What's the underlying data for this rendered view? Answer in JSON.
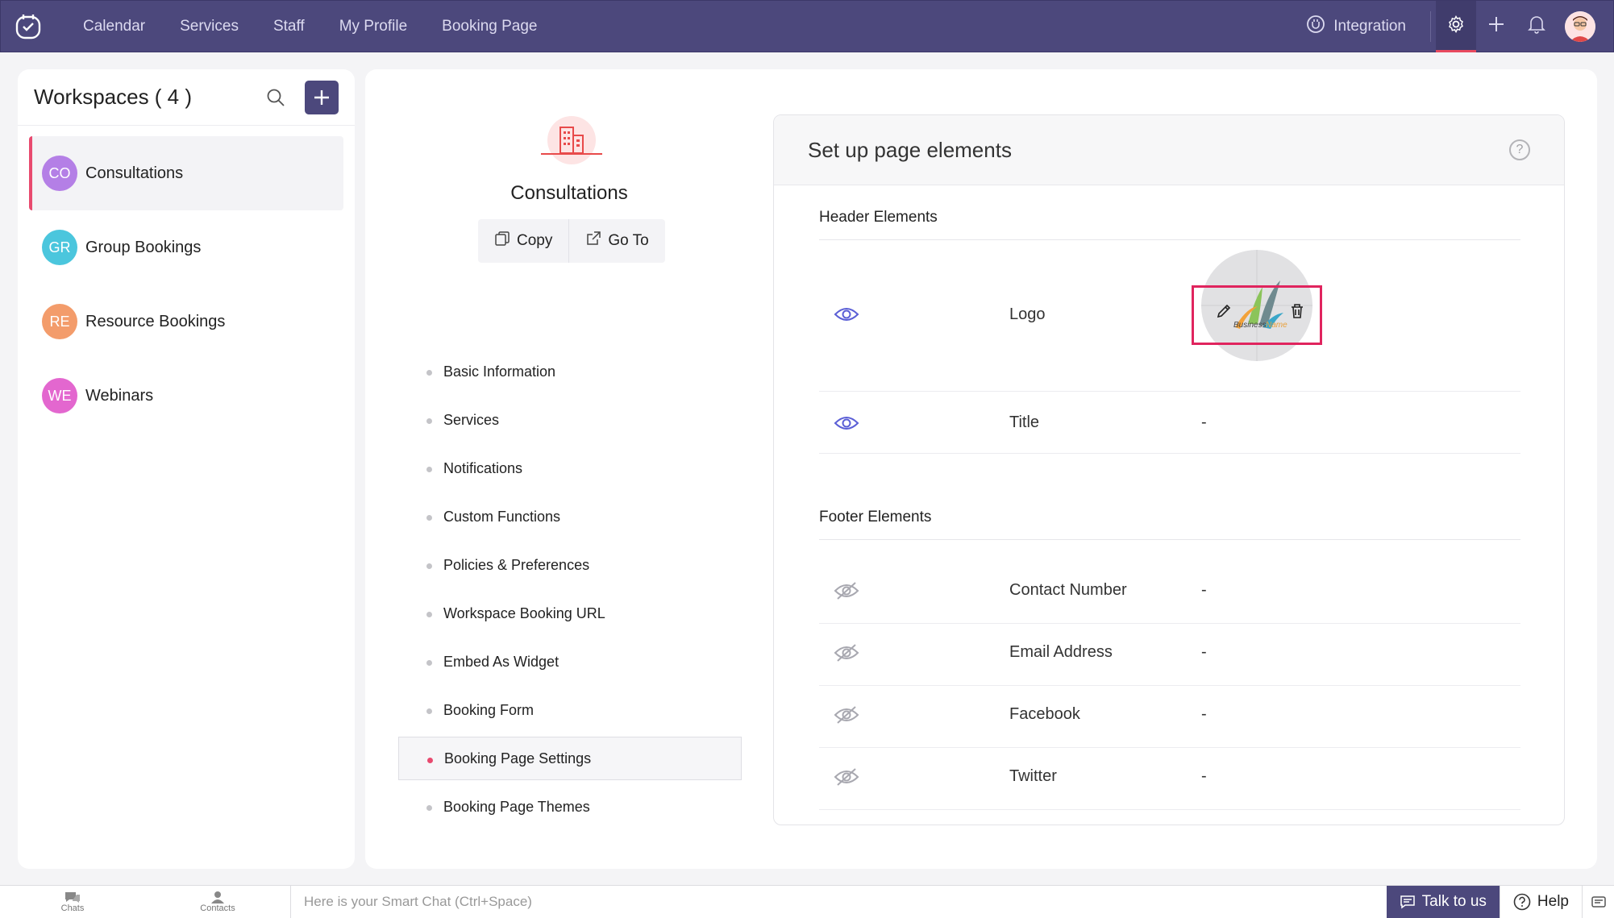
{
  "nav": {
    "links": [
      "Calendar",
      "Services",
      "Staff",
      "My Profile",
      "Booking Page"
    ],
    "integration": "Integration"
  },
  "sidebar": {
    "title": "Workspaces ( 4 )",
    "items": [
      {
        "initials": "CO",
        "label": "Consultations",
        "color": "#b47fe6"
      },
      {
        "initials": "GR",
        "label": "Group Bookings",
        "color": "#4bc6dd"
      },
      {
        "initials": "RE",
        "label": "Resource Bookings",
        "color": "#f39c6b"
      },
      {
        "initials": "WE",
        "label": "Webinars",
        "color": "#e367cf"
      }
    ]
  },
  "workspace": {
    "name": "Consultations",
    "copy_label": "Copy",
    "goto_label": "Go To"
  },
  "menu": [
    "Basic Information",
    "Services",
    "Notifications",
    "Custom Functions",
    "Policies & Preferences",
    "Workspace Booking URL",
    "Embed As Widget",
    "Booking Form",
    "Booking Page Settings",
    "Booking Page Themes"
  ],
  "card": {
    "title": "Set up page elements",
    "header_section": "Header Elements",
    "footer_section": "Footer Elements",
    "header_rows": [
      {
        "label": "Logo",
        "value": ""
      },
      {
        "label": "Title",
        "value": "-"
      }
    ],
    "footer_rows": [
      {
        "label": "Contact Number",
        "value": "-"
      },
      {
        "label": "Email Address",
        "value": "-"
      },
      {
        "label": "Facebook",
        "value": "-"
      },
      {
        "label": "Twitter",
        "value": "-"
      }
    ],
    "logo_text_a": "Business",
    "logo_text_b": "Name"
  },
  "bottom": {
    "chats": "Chats",
    "contacts": "Contacts",
    "smartchat_placeholder": "Here is your Smart Chat (Ctrl+Space)",
    "talk": "Talk to us",
    "help": "Help"
  },
  "colors": {
    "accent": "#4c487c",
    "highlight": "#e0245e",
    "active_marker": "#e84a6f"
  }
}
